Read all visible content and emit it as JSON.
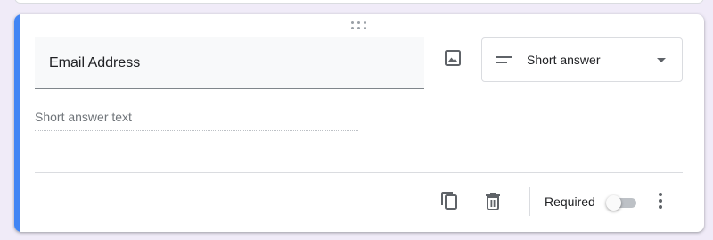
{
  "question": {
    "title": "Email Address",
    "answer_placeholder": "Short answer text"
  },
  "type_select": {
    "selected": "Short answer",
    "icon": "short-text-icon"
  },
  "toolbar": {
    "required_label": "Required",
    "required_on": false,
    "icons": [
      "image-icon",
      "duplicate-icon",
      "delete-icon",
      "more-vert-icon"
    ]
  },
  "colors": {
    "background": "#f0ebf8",
    "accent": "#4285f4",
    "toggle_off": "#bdc1c6"
  }
}
